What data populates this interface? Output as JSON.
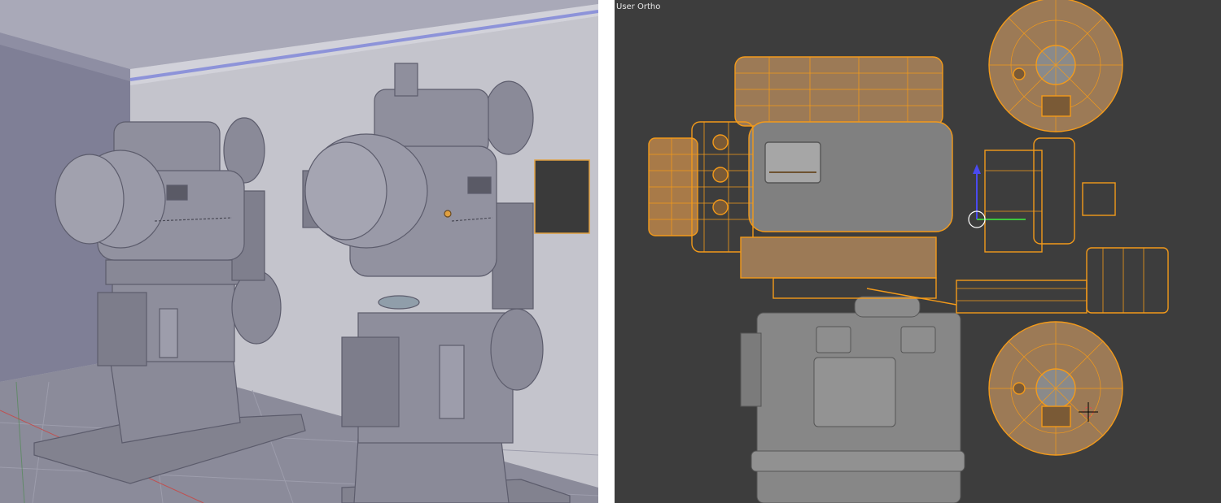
{
  "viewports": {
    "left": {
      "shading": "solid",
      "view": "perspective"
    },
    "right": {
      "label": "User Ortho",
      "selection_color": "#f39a1a",
      "background": "#3d3d3d"
    }
  },
  "colors": {
    "model_gray": "#8a8a98",
    "room_wall": "#c6c6cf",
    "floor": "#8d8d9c",
    "wire_orange": "#f39a1a"
  }
}
